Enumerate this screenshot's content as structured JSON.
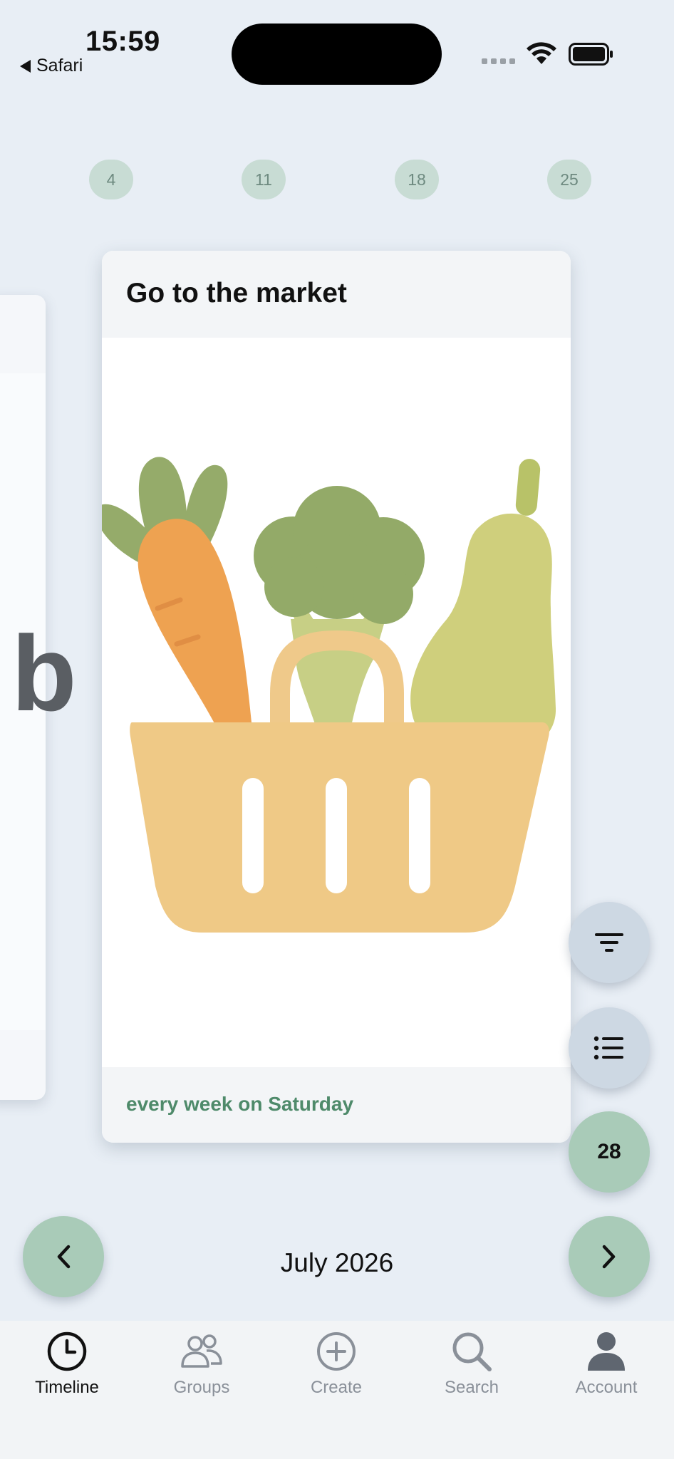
{
  "status_bar": {
    "time": "15:59",
    "back_app": "Safari"
  },
  "week_strip": [
    {
      "day": "4"
    },
    {
      "day": "11"
    },
    {
      "day": "18"
    },
    {
      "day": "25"
    }
  ],
  "peek_card": {
    "visible_letter": "b"
  },
  "card": {
    "title": "Go to the market",
    "recurrence": "every week on Saturday",
    "illustration_icon": "vegetable-basket-illustration"
  },
  "floating_buttons": {
    "filter_icon": "filter-icon",
    "list_icon": "list-icon",
    "today_label": "28"
  },
  "month_nav": {
    "month_label": "July 2026",
    "prev_icon": "chevron-left-icon",
    "next_icon": "chevron-right-icon"
  },
  "tabs": [
    {
      "label": "Timeline",
      "icon": "clock-icon",
      "active": true
    },
    {
      "label": "Groups",
      "icon": "group-icon",
      "active": false
    },
    {
      "label": "Create",
      "icon": "plus-circle-icon",
      "active": false
    },
    {
      "label": "Search",
      "icon": "search-icon",
      "active": false
    },
    {
      "label": "Account",
      "icon": "person-icon",
      "active": false
    }
  ],
  "colors": {
    "background": "#e8eef5",
    "accent_green": "#a9cbb8",
    "recurrence_text": "#4e8a6a",
    "fab_blue": "#cdd8e3"
  }
}
